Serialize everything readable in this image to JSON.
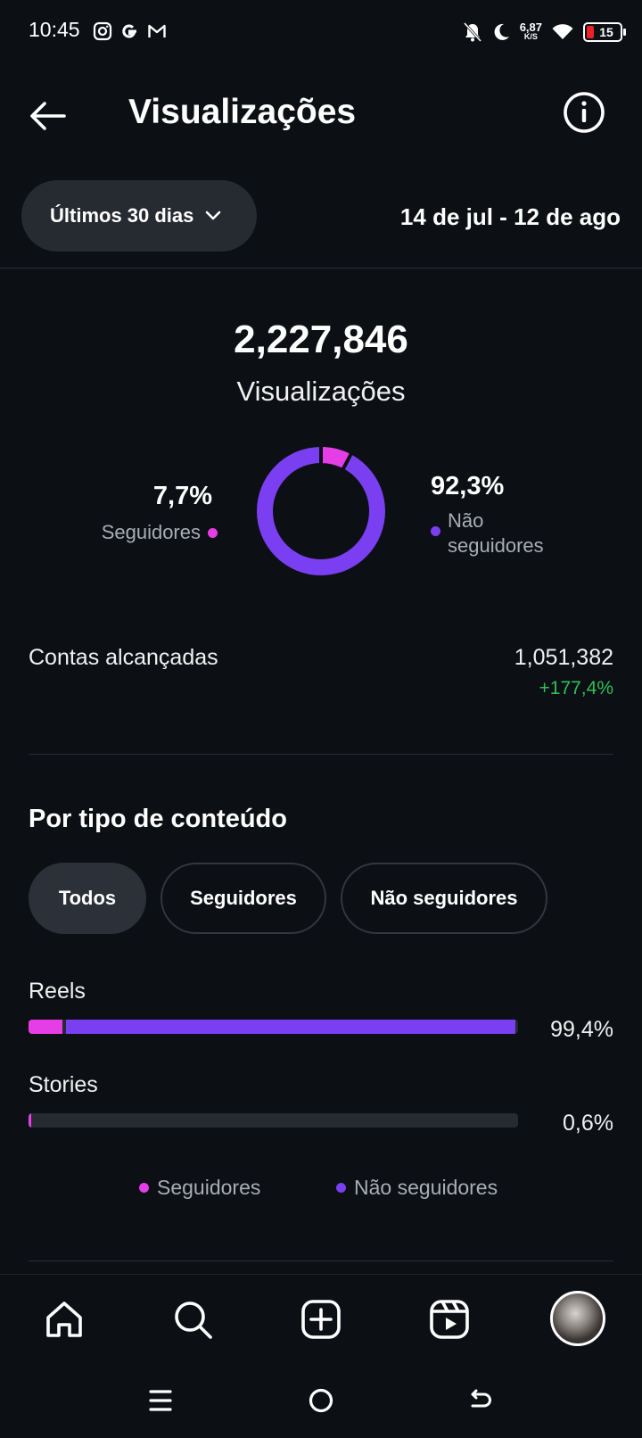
{
  "status_bar": {
    "time": "10:45",
    "speed_value": "6,87",
    "speed_unit": "K/S",
    "battery": "15"
  },
  "header": {
    "title": "Visualizações"
  },
  "filter": {
    "range_label": "Últimos 30 dias",
    "date_range": "14 de jul - 12 de ago"
  },
  "summary": {
    "total": "2,227,846",
    "total_label": "Visualizações",
    "followers_pct": "7,7%",
    "followers_label": "Seguidores",
    "non_followers_pct": "92,3%",
    "non_followers_label": "Não seguidores",
    "followers_fraction": 0.077
  },
  "reach": {
    "label": "Contas alcançadas",
    "value": "1,051,382",
    "change": "+177,4%"
  },
  "content_type": {
    "title": "Por tipo de conteúdo",
    "chips": [
      "Todos",
      "Seguidores",
      "Não seguidores"
    ],
    "active_chip": "Todos",
    "rows": [
      {
        "label": "Reels",
        "pct": "99,4%",
        "total_fraction": 0.994,
        "followers_fraction": 0.07
      },
      {
        "label": "Stories",
        "pct": "0,6%",
        "total_fraction": 0.006,
        "followers_fraction": 0.006
      }
    ],
    "legend": [
      "Seguidores",
      "Não seguidores"
    ]
  },
  "colors": {
    "followers": "#e63ee6",
    "non_followers": "#7b3ff2",
    "positive": "#2fbf5b"
  },
  "icons": {
    "status": [
      "instagram-icon",
      "google-icon",
      "gmail-icon",
      "dnd-bell-icon",
      "moon-icon",
      "wifi-icon",
      "battery-icon"
    ],
    "nav": [
      "home-icon",
      "search-icon",
      "create-icon",
      "reels-icon",
      "profile-avatar"
    ],
    "system": [
      "recents-icon",
      "home-circle-icon",
      "back-icon"
    ]
  }
}
